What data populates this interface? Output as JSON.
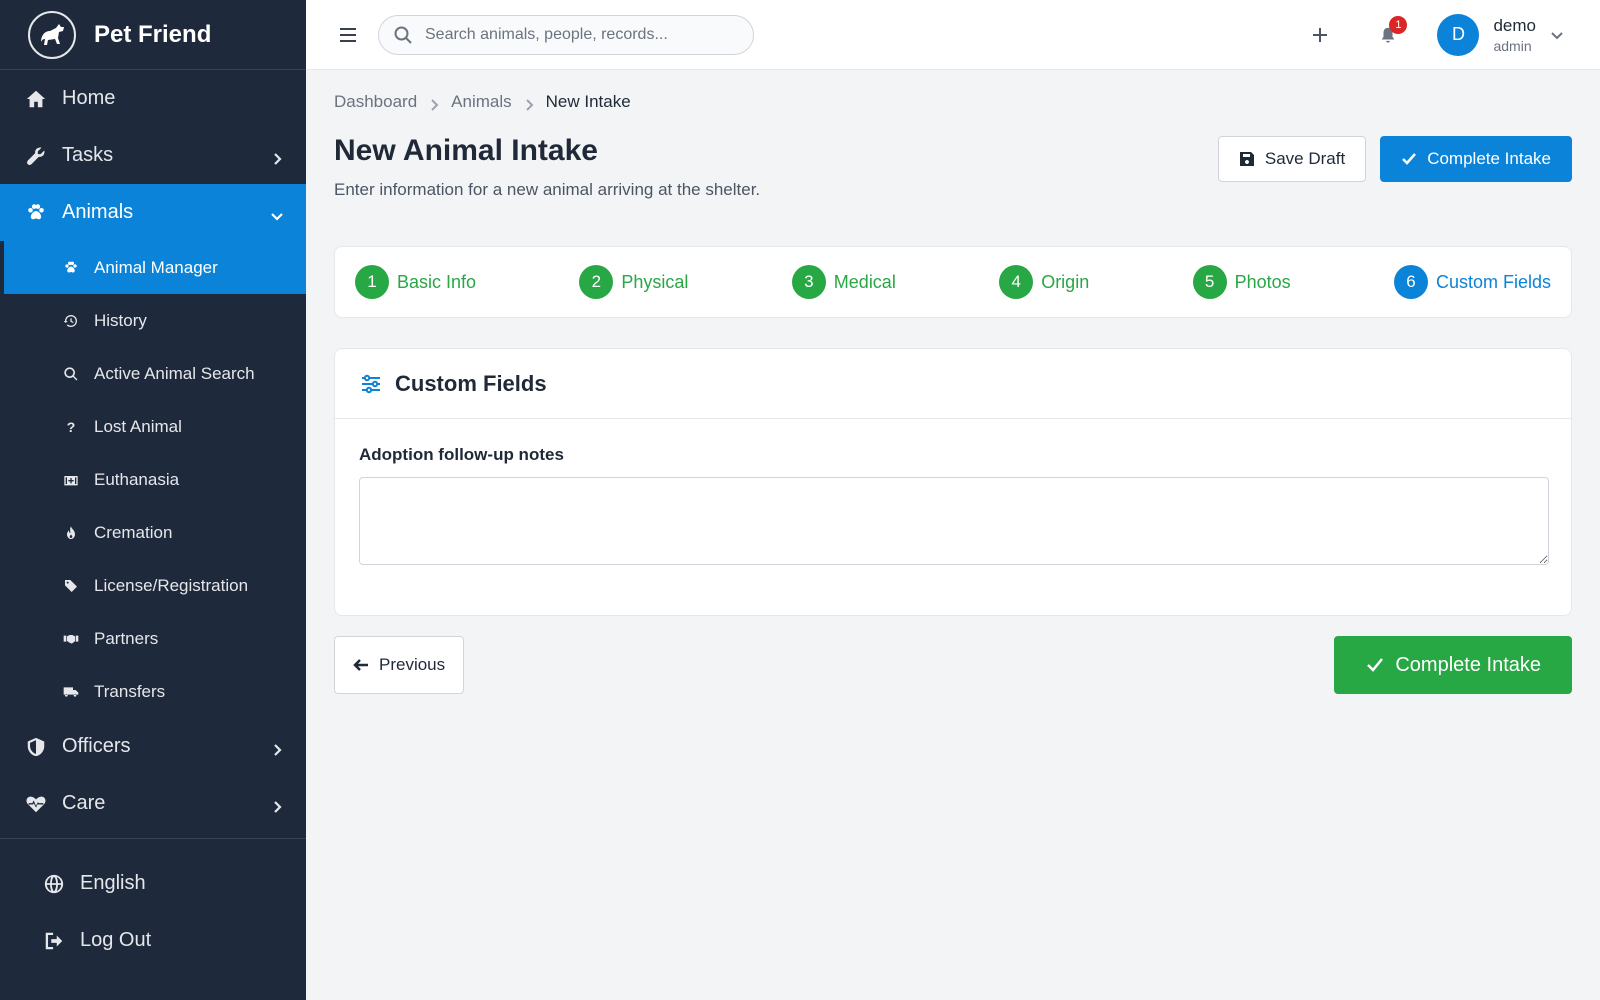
{
  "app": {
    "name": "Pet Friend"
  },
  "sidebar": {
    "items": [
      {
        "label": "Home",
        "icon": "home-icon"
      },
      {
        "label": "Tasks",
        "icon": "wrench-icon"
      },
      {
        "label": "Animals",
        "icon": "paw-icon"
      },
      {
        "label": "Officers",
        "icon": "shield-icon"
      },
      {
        "label": "Care",
        "icon": "heartbeat-icon"
      }
    ],
    "animals_submenu": [
      {
        "label": "Animal Manager",
        "icon": "paw-icon"
      },
      {
        "label": "History",
        "icon": "history-icon"
      },
      {
        "label": "Active Animal Search",
        "icon": "search-icon"
      },
      {
        "label": "Lost Animal",
        "icon": "question-icon"
      },
      {
        "label": "Euthanasia",
        "icon": "medical-kit-icon"
      },
      {
        "label": "Cremation",
        "icon": "fire-icon"
      },
      {
        "label": "License/Registration",
        "icon": "tag-icon"
      },
      {
        "label": "Partners",
        "icon": "handshake-icon"
      },
      {
        "label": "Transfers",
        "icon": "truck-icon"
      }
    ],
    "bottom": [
      {
        "label": "English",
        "icon": "globe-icon"
      },
      {
        "label": "Log Out",
        "icon": "logout-icon"
      }
    ]
  },
  "topbar": {
    "search_placeholder": "Search animals, people, records...",
    "notification_count": "1",
    "user": {
      "initial": "D",
      "name": "demo",
      "role": "admin"
    }
  },
  "breadcrumb": [
    "Dashboard",
    "Animals",
    "New Intake"
  ],
  "page": {
    "title": "New Animal Intake",
    "subtitle": "Enter information for a new animal arriving at the shelter.",
    "save_draft_label": "Save Draft",
    "complete_intake_label": "Complete Intake"
  },
  "steps": [
    {
      "number": "1",
      "label": "Basic Info",
      "state": "complete"
    },
    {
      "number": "2",
      "label": "Physical",
      "state": "complete"
    },
    {
      "number": "3",
      "label": "Medical",
      "state": "complete"
    },
    {
      "number": "4",
      "label": "Origin",
      "state": "complete"
    },
    {
      "number": "5",
      "label": "Photos",
      "state": "complete"
    },
    {
      "number": "6",
      "label": "Custom Fields",
      "state": "current"
    }
  ],
  "card": {
    "title": "Custom Fields",
    "field_label": "Adoption follow-up notes",
    "field_value": ""
  },
  "footer": {
    "previous_label": "Previous",
    "complete_label": "Complete Intake"
  },
  "colors": {
    "sidebar_bg": "#1e293b",
    "primary": "#0b83d9",
    "success": "#28a745",
    "badge": "#dc2626"
  }
}
